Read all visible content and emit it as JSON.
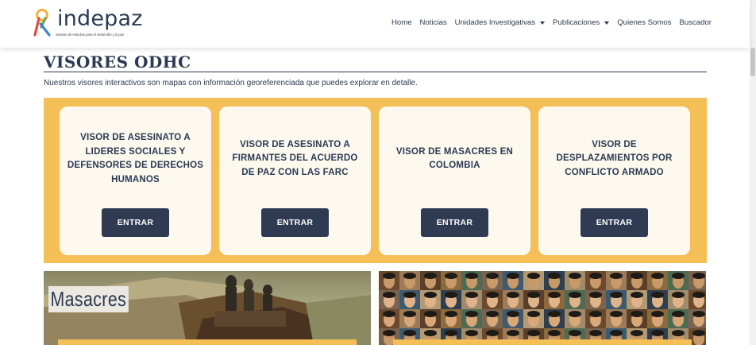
{
  "header": {
    "logo_text": "indepaz",
    "logo_subtitle": "instituto de estudios para el desarrollo y la paz",
    "nav": [
      {
        "label": "Home",
        "has_caret": false
      },
      {
        "label": "Noticias",
        "has_caret": false
      },
      {
        "label": "Unidades Investigativas",
        "has_caret": true
      },
      {
        "label": "Publicaciones",
        "has_caret": true
      },
      {
        "label": "Quienes Somos",
        "has_caret": false
      },
      {
        "label": "Buscador",
        "has_caret": false
      }
    ]
  },
  "section": {
    "title": "VISORES ODHC",
    "intro": "Nuestros visores interactivos son mapas con información georeferenciada que puedes explorar en detalle."
  },
  "cards": [
    {
      "title": "VISOR DE ASESINATO A LIDERES SOCIALES Y DEFENSORES DE DERECHOS HUMANOS",
      "button": "ENTRAR"
    },
    {
      "title": "VISOR DE ASESINATO A FIRMANTES DEL ACUERDO DE PAZ CON LAS FARC",
      "button": "ENTRAR"
    },
    {
      "title": "VISOR DE MASACRES EN COLOMBIA",
      "button": "ENTRAR"
    },
    {
      "title": "VISOR DE DESPLAZAMIENTOS POR CONFLICTO ARMADO",
      "button": "ENTRAR"
    }
  ],
  "images": {
    "masacres_label": "Masacres"
  },
  "colors": {
    "accent_yellow": "#f5bf58",
    "navy": "#2b3a52",
    "button": "#2f3b53",
    "card_bg": "#fdf9ef"
  }
}
